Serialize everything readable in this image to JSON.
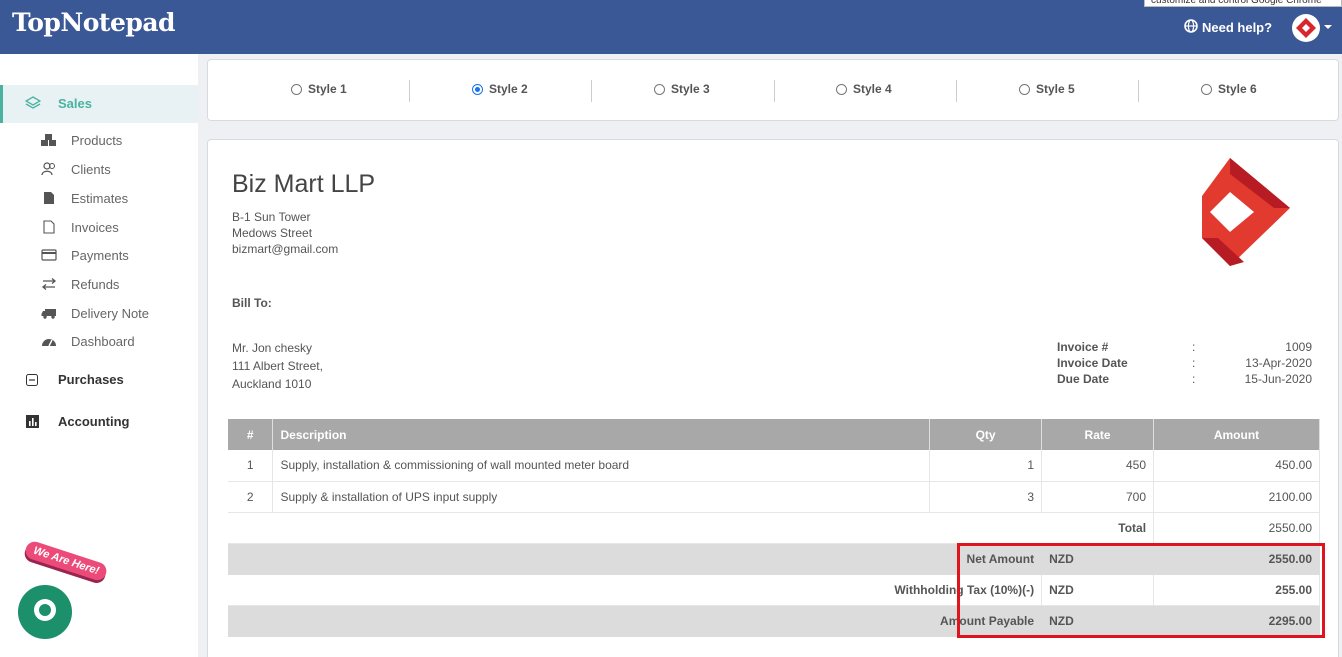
{
  "header": {
    "logo": "TopNotepad",
    "tooltip_text": "customize and control Google Chrome",
    "help_label": "Need help?"
  },
  "sidebar": {
    "sales_label": "Sales",
    "items": [
      {
        "label": "Products",
        "icon": "cubes-icon"
      },
      {
        "label": "Clients",
        "icon": "users-icon"
      },
      {
        "label": "Estimates",
        "icon": "file-icon"
      },
      {
        "label": "Invoices",
        "icon": "file-outline-icon"
      },
      {
        "label": "Payments",
        "icon": "credit-card-icon"
      },
      {
        "label": "Refunds",
        "icon": "exchange-icon"
      },
      {
        "label": "Delivery Note",
        "icon": "truck-icon"
      },
      {
        "label": "Dashboard",
        "icon": "dashboard-icon"
      }
    ],
    "purchases_label": "Purchases",
    "accounting_label": "Accounting"
  },
  "styles": {
    "options": [
      "Style 1",
      "Style 2",
      "Style 3",
      "Style 4",
      "Style 5",
      "Style 6"
    ],
    "selected": "Style 2"
  },
  "invoice": {
    "company": "Biz Mart LLP",
    "address": [
      "B-1 Sun Tower",
      "Medows Street",
      "bizmart@gmail.com"
    ],
    "bill_to_label": "Bill To:",
    "client": [
      "Mr. Jon chesky",
      "111 Albert Street,",
      "Auckland 1010"
    ],
    "meta": [
      {
        "key": "Invoice #",
        "value": "1009"
      },
      {
        "key": "Invoice Date",
        "value": "13-Apr-2020"
      },
      {
        "key": "Due Date",
        "value": "15-Jun-2020"
      }
    ],
    "meta_separator": ":",
    "table": {
      "headers": [
        "#",
        "Description",
        "Qty",
        "Rate",
        "Amount"
      ],
      "rows": [
        {
          "num": "1",
          "desc": "Supply, installation & commissioning of wall mounted meter board",
          "qty": "1",
          "rate": "450",
          "amount": "450.00"
        },
        {
          "num": "2",
          "desc": "Supply & installation of UPS input supply",
          "qty": "3",
          "rate": "700",
          "amount": "2100.00"
        }
      ],
      "total_label": "Total",
      "total_value": "2550.00",
      "summary": [
        {
          "label": "Net Amount",
          "currency": "NZD",
          "value": "2550.00"
        },
        {
          "label": "Withholding Tax (10%)(-)",
          "currency": "NZD",
          "value": "255.00"
        },
        {
          "label": "Amount Payable",
          "currency": "NZD",
          "value": "2295.00"
        }
      ]
    }
  },
  "chat": {
    "badge": "We Are Here!"
  },
  "colors": {
    "header": "#3b5896",
    "accent": "#49b3a0",
    "highlight": "#e0141e",
    "chat": "#1c8f6b"
  }
}
